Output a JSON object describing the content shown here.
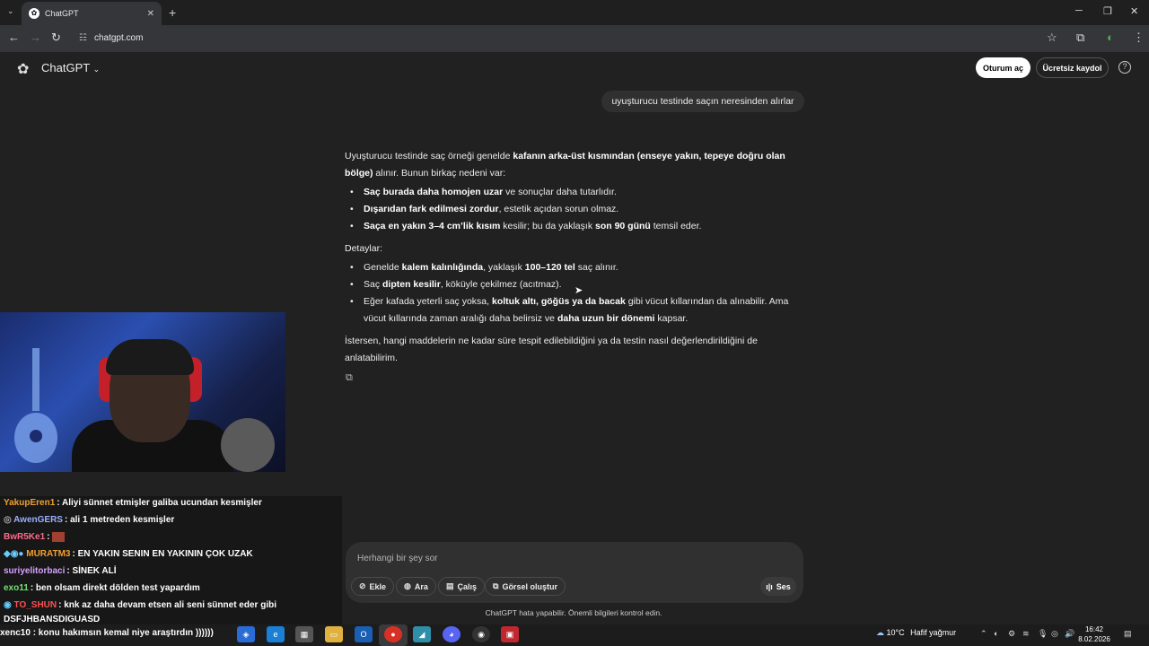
{
  "browser": {
    "tab_title": "ChatGPT",
    "url": "chatgpt.com"
  },
  "header": {
    "app_name": "ChatGPT",
    "login": "Oturum aç",
    "signup": "Ücretsiz kaydol",
    "help": "?"
  },
  "conversation": {
    "user_message": "uyuşturucu testinde saçın neresinden alırlar",
    "answer": {
      "intro_a": "Uyuşturucu testinde saç örneği genelde ",
      "intro_b": "kafanın arka-üst kısmından (enseye yakın, tepeye doğru olan bölge)",
      "intro_c": " alınır. Bunun birkaç nedeni var:",
      "reasons": [
        {
          "bold": "Saç burada daha homojen uzar",
          "rest": " ve sonuçlar daha tutarlıdır."
        },
        {
          "bold": "Dışarıdan fark edilmesi zordur",
          "rest": ", estetik açıdan sorun olmaz."
        },
        {
          "bold": "Saça en yakın 3–4 cm’lik kısım",
          "rest": " kesilir; bu da yaklaşık ",
          "bold2": "son 90 günü",
          "rest2": " temsil eder."
        }
      ],
      "details_label": "Detaylar:",
      "details": [
        {
          "pre": "Genelde ",
          "bold": "kalem kalınlığında",
          "mid": ", yaklaşık ",
          "bold2": "100–120 tel",
          "post": " saç alınır."
        },
        {
          "pre": "Saç ",
          "bold": "dipten kesilir",
          "mid": ", köküyle çekilmez (acıtmaz).",
          "bold2": "",
          "post": ""
        },
        {
          "pre": "Eğer kafada yeterli saç yoksa, ",
          "bold": "koltuk altı, göğüs ya da bacak",
          "mid": " gibi vücut kıllarından da alınabilir. Ama vücut kıllarında zaman aralığı daha belirsiz ve ",
          "bold2": "daha uzun bir dönemi",
          "post": " kapsar."
        }
      ],
      "outro": "İstersen, hangi maddelerin ne kadar süre tespit edilebildiğini ya da testin nasıl değerlendirildiğini de anlatabilirim."
    }
  },
  "composer": {
    "placeholder": "Herhangi bir şey sor",
    "buttons": [
      "Ekle",
      "Ara",
      "Çalış",
      "Görsel oluştur"
    ],
    "voice": "Ses",
    "disclaimer": "ChatGPT hata yapabilir. Önemli bilgileri kontrol edin."
  },
  "stream_chat": [
    {
      "user": "YakupEren1",
      "color": "#f0a030",
      "text": ": Aliyi sünnet etmişler galiba ucundan kesmişler"
    },
    {
      "user": "AwenGERS",
      "color": "#9ab0ff",
      "text": ": ali 1 metreden kesmişler"
    },
    {
      "user": "BwR5Ke1",
      "color": "#ff6a8a",
      "text": ":"
    },
    {
      "user": "MURATM3",
      "color": "#f0a030",
      "text": ": EN YAKIN SENIN EN YAKININ ÇOK UZAK"
    },
    {
      "user": "suriyelitorbaci",
      "color": "#d8a0ff",
      "text": ": SİNEK ALİ"
    },
    {
      "user": "exo11",
      "color": "#70e070",
      "text": ": ben olsam direkt dölden test yapardım"
    },
    {
      "user": "TO_SHUN",
      "color": "#ff5050",
      "text": ": knk az daha devam etsen ali seni sünnet eder gibi"
    },
    {
      "user": "",
      "color": "#ffffff",
      "text": "DSFJHBANSDIGUASD"
    }
  ],
  "ticker": "xenc10 : konu hakımsın kemal niye araştırdın ))))))",
  "taskbar": {
    "weather_temp": "10°C",
    "weather_text": "Hafif yağmur",
    "time": "16:42",
    "date": "8.02.2026"
  }
}
